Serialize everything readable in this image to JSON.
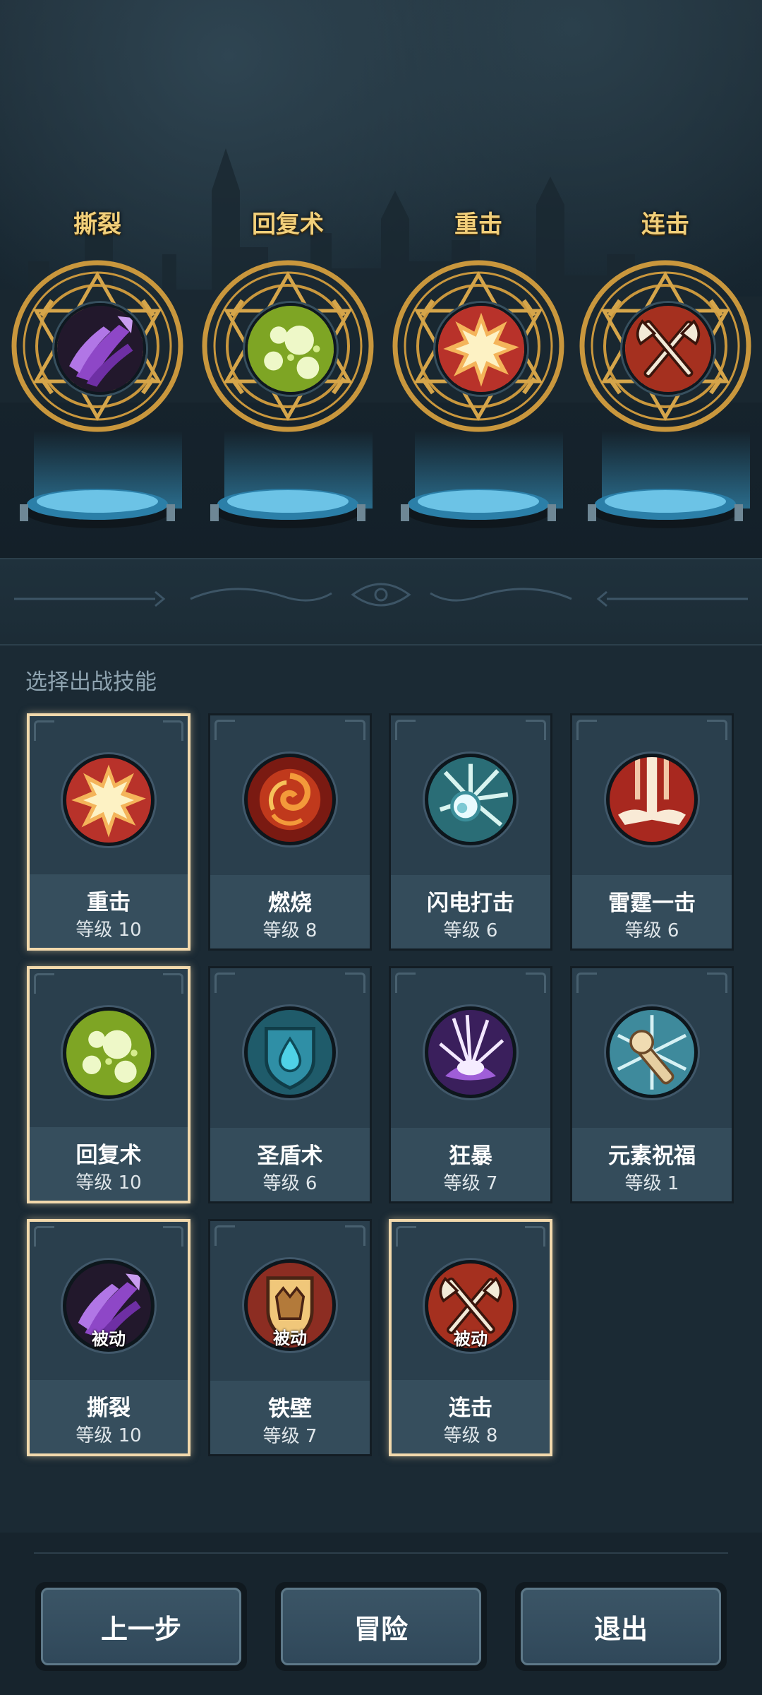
{
  "equipped_slots": [
    {
      "label": "撕裂",
      "icon": "purple-claw-icon"
    },
    {
      "label": "回复术",
      "icon": "green-orbs-icon"
    },
    {
      "label": "重击",
      "icon": "impact-burst-icon"
    },
    {
      "label": "连击",
      "icon": "crossed-axes-icon"
    }
  ],
  "section_label": "选择出战技能",
  "skills": [
    {
      "name": "重击",
      "level": "等级 10",
      "icon": "impact-burst-icon",
      "selected": true,
      "passive": ""
    },
    {
      "name": "燃烧",
      "level": "等级 8",
      "icon": "fire-swirl-icon",
      "selected": false,
      "passive": ""
    },
    {
      "name": "闪电打击",
      "level": "等级 6",
      "icon": "lightning-orb-icon",
      "selected": false,
      "passive": ""
    },
    {
      "name": "雷霆一击",
      "level": "等级 6",
      "icon": "thunder-strike-icon",
      "selected": false,
      "passive": ""
    },
    {
      "name": "回复术",
      "level": "等级 10",
      "icon": "green-orbs-icon",
      "selected": true,
      "passive": ""
    },
    {
      "name": "圣盾术",
      "level": "等级 6",
      "icon": "water-shield-icon",
      "selected": false,
      "passive": ""
    },
    {
      "name": "狂暴",
      "level": "等级 7",
      "icon": "rage-burst-icon",
      "selected": false,
      "passive": ""
    },
    {
      "name": "元素祝福",
      "level": "等级 1",
      "icon": "blessing-staff-icon",
      "selected": false,
      "passive": ""
    },
    {
      "name": "撕裂",
      "level": "等级 10",
      "icon": "purple-claw-icon",
      "selected": true,
      "passive": "被动"
    },
    {
      "name": "铁壁",
      "level": "等级 7",
      "icon": "iron-shield-icon",
      "selected": false,
      "passive": "被动"
    },
    {
      "name": "连击",
      "level": "等级 8",
      "icon": "crossed-axes-icon",
      "selected": true,
      "passive": "被动"
    }
  ],
  "buttons": {
    "prev": "上一步",
    "adventure": "冒险",
    "exit": "退出"
  }
}
